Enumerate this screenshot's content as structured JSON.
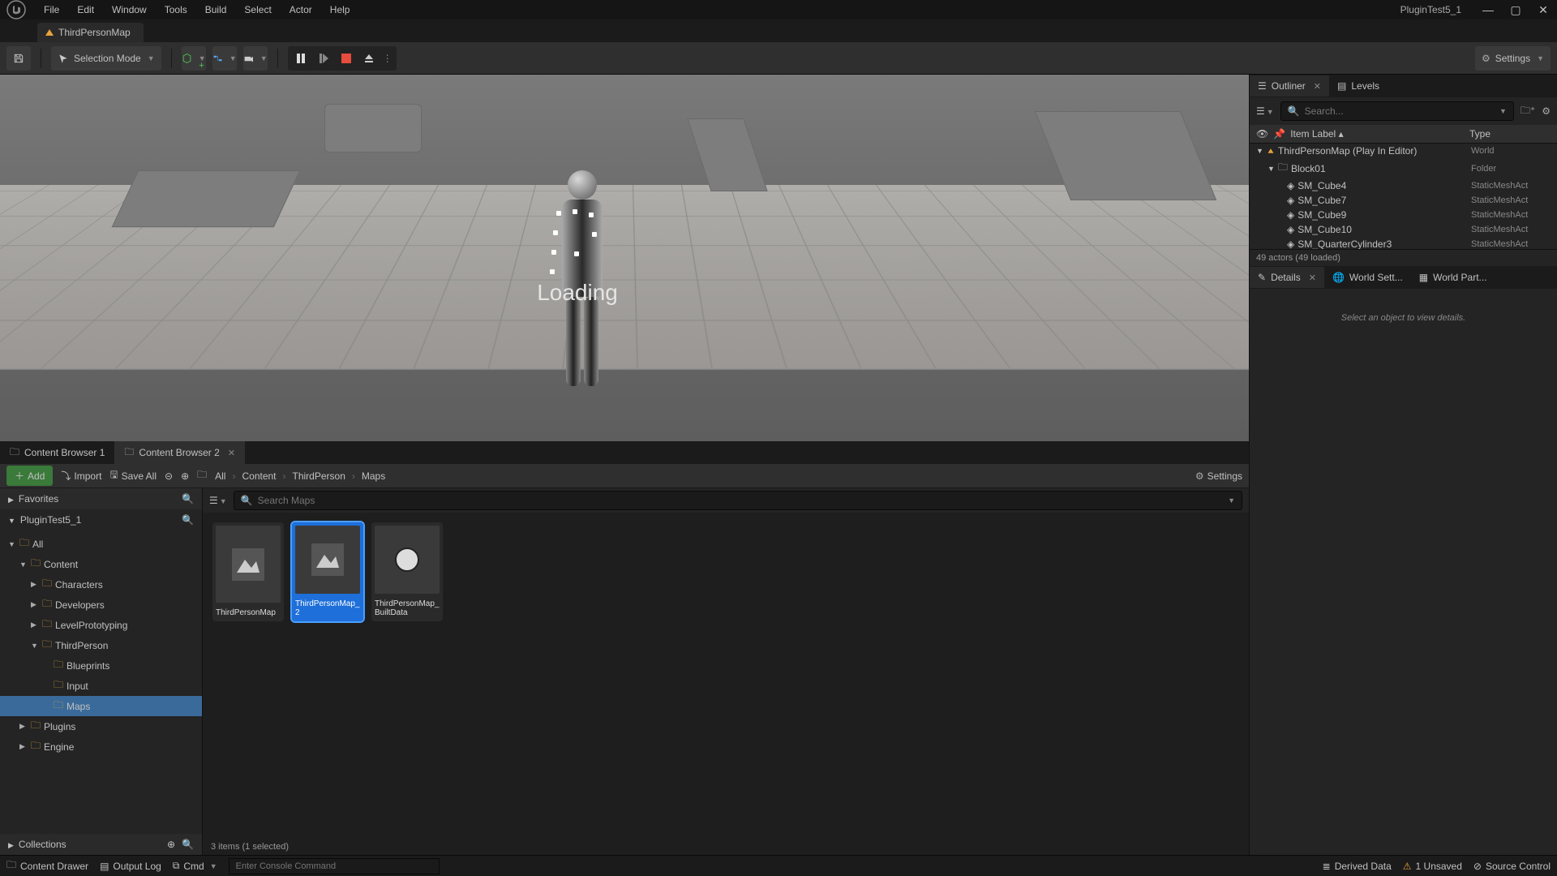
{
  "app": {
    "project_title": "PluginTest5_1"
  },
  "menu": [
    "File",
    "Edit",
    "Window",
    "Tools",
    "Build",
    "Select",
    "Actor",
    "Help"
  ],
  "doc_tab": "ThirdPersonMap",
  "toolbar": {
    "mode": "Selection Mode",
    "settings": "Settings"
  },
  "viewport": {
    "overlay": "Loading"
  },
  "content_browser": {
    "tabs": [
      "Content Browser 1",
      "Content Browser 2"
    ],
    "add": "Add",
    "import": "Import",
    "saveall": "Save All",
    "breadcrumb": [
      "All",
      "Content",
      "ThirdPerson",
      "Maps"
    ],
    "settings": "Settings",
    "favorites": "Favorites",
    "project": "PluginTest5_1",
    "collections": "Collections",
    "tree": {
      "all": "All",
      "content": "Content",
      "characters": "Characters",
      "developers": "Developers",
      "levelproto": "LevelPrototyping",
      "thirdperson": "ThirdPerson",
      "blueprints": "Blueprints",
      "input": "Input",
      "maps": "Maps",
      "plugins": "Plugins",
      "engine": "Engine"
    },
    "search_placeholder": "Search Maps",
    "assets": [
      {
        "name": "ThirdPersonMap"
      },
      {
        "name": "ThirdPersonMap_2"
      },
      {
        "name": "ThirdPersonMap_BuiltData"
      }
    ],
    "status": "3 items (1 selected)"
  },
  "outliner": {
    "tab": "Outliner",
    "levels_tab": "Levels",
    "search_placeholder": "Search...",
    "col_label": "Item Label",
    "col_type": "Type",
    "root": "ThirdPersonMap (Play In Editor)",
    "root_type": "World",
    "folder": "Block01",
    "folder_type": "Folder",
    "items": [
      {
        "name": "SM_Cube4",
        "type": "StaticMeshAct"
      },
      {
        "name": "SM_Cube7",
        "type": "StaticMeshAct"
      },
      {
        "name": "SM_Cube9",
        "type": "StaticMeshAct"
      },
      {
        "name": "SM_Cube10",
        "type": "StaticMeshAct"
      },
      {
        "name": "SM_QuarterCylinder3",
        "type": "StaticMeshAct"
      }
    ],
    "status": "49 actors (49 loaded)"
  },
  "details": {
    "tab_details": "Details",
    "tab_world": "World Sett...",
    "tab_partition": "World Part...",
    "empty": "Select an object to view details."
  },
  "bottom": {
    "drawer": "Content Drawer",
    "outputlog": "Output Log",
    "cmd_label": "Cmd",
    "cmd_placeholder": "Enter Console Command",
    "derived": "Derived Data",
    "unsaved": "1 Unsaved",
    "source": "Source Control"
  }
}
